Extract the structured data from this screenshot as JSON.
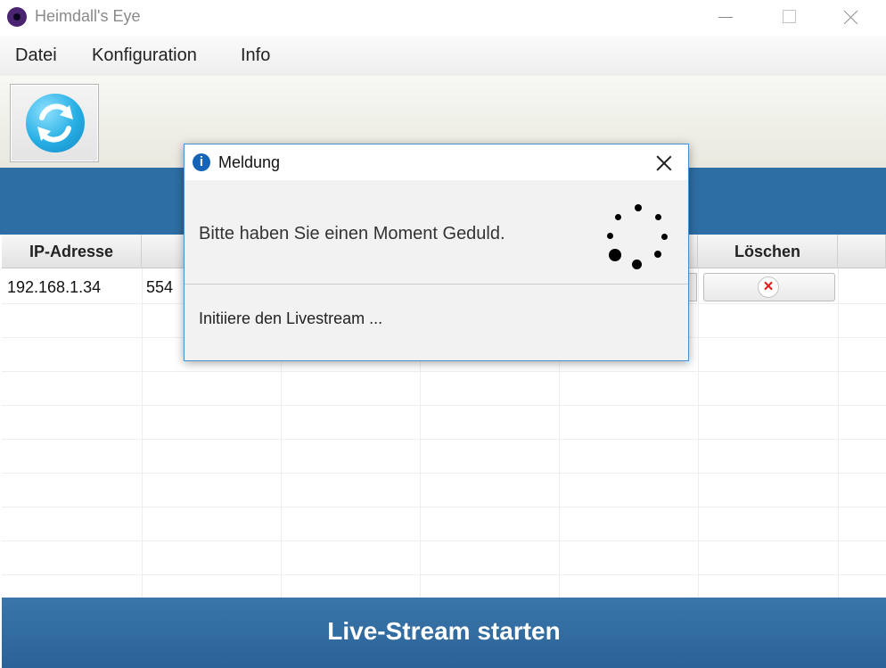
{
  "window": {
    "title": "Heimdall's Eye",
    "controls": [
      "minimize",
      "maximize",
      "close"
    ]
  },
  "menu": {
    "items": [
      "Datei",
      "Konfiguration",
      "Info"
    ]
  },
  "toolbar": {
    "button_icon": "refresh-icon"
  },
  "table": {
    "columns": [
      "IP-Adresse",
      "",
      "",
      "",
      "",
      "Löschen",
      ""
    ],
    "rows": [
      {
        "ip": "192.168.1.34",
        "port": "554",
        "delete_icon": "red-x-icon"
      }
    ]
  },
  "dialog": {
    "title": "Meldung",
    "message": "Bitte haben Sie einen Moment Geduld.",
    "status": "Initiiere den Livestream ...",
    "icon": "info-icon"
  },
  "bottom_button": {
    "label": "Live-Stream starten"
  },
  "colors": {
    "blue": "#2d6ea4",
    "dialog_border": "#4a90d0",
    "delete_icon": "#e11d1d"
  }
}
